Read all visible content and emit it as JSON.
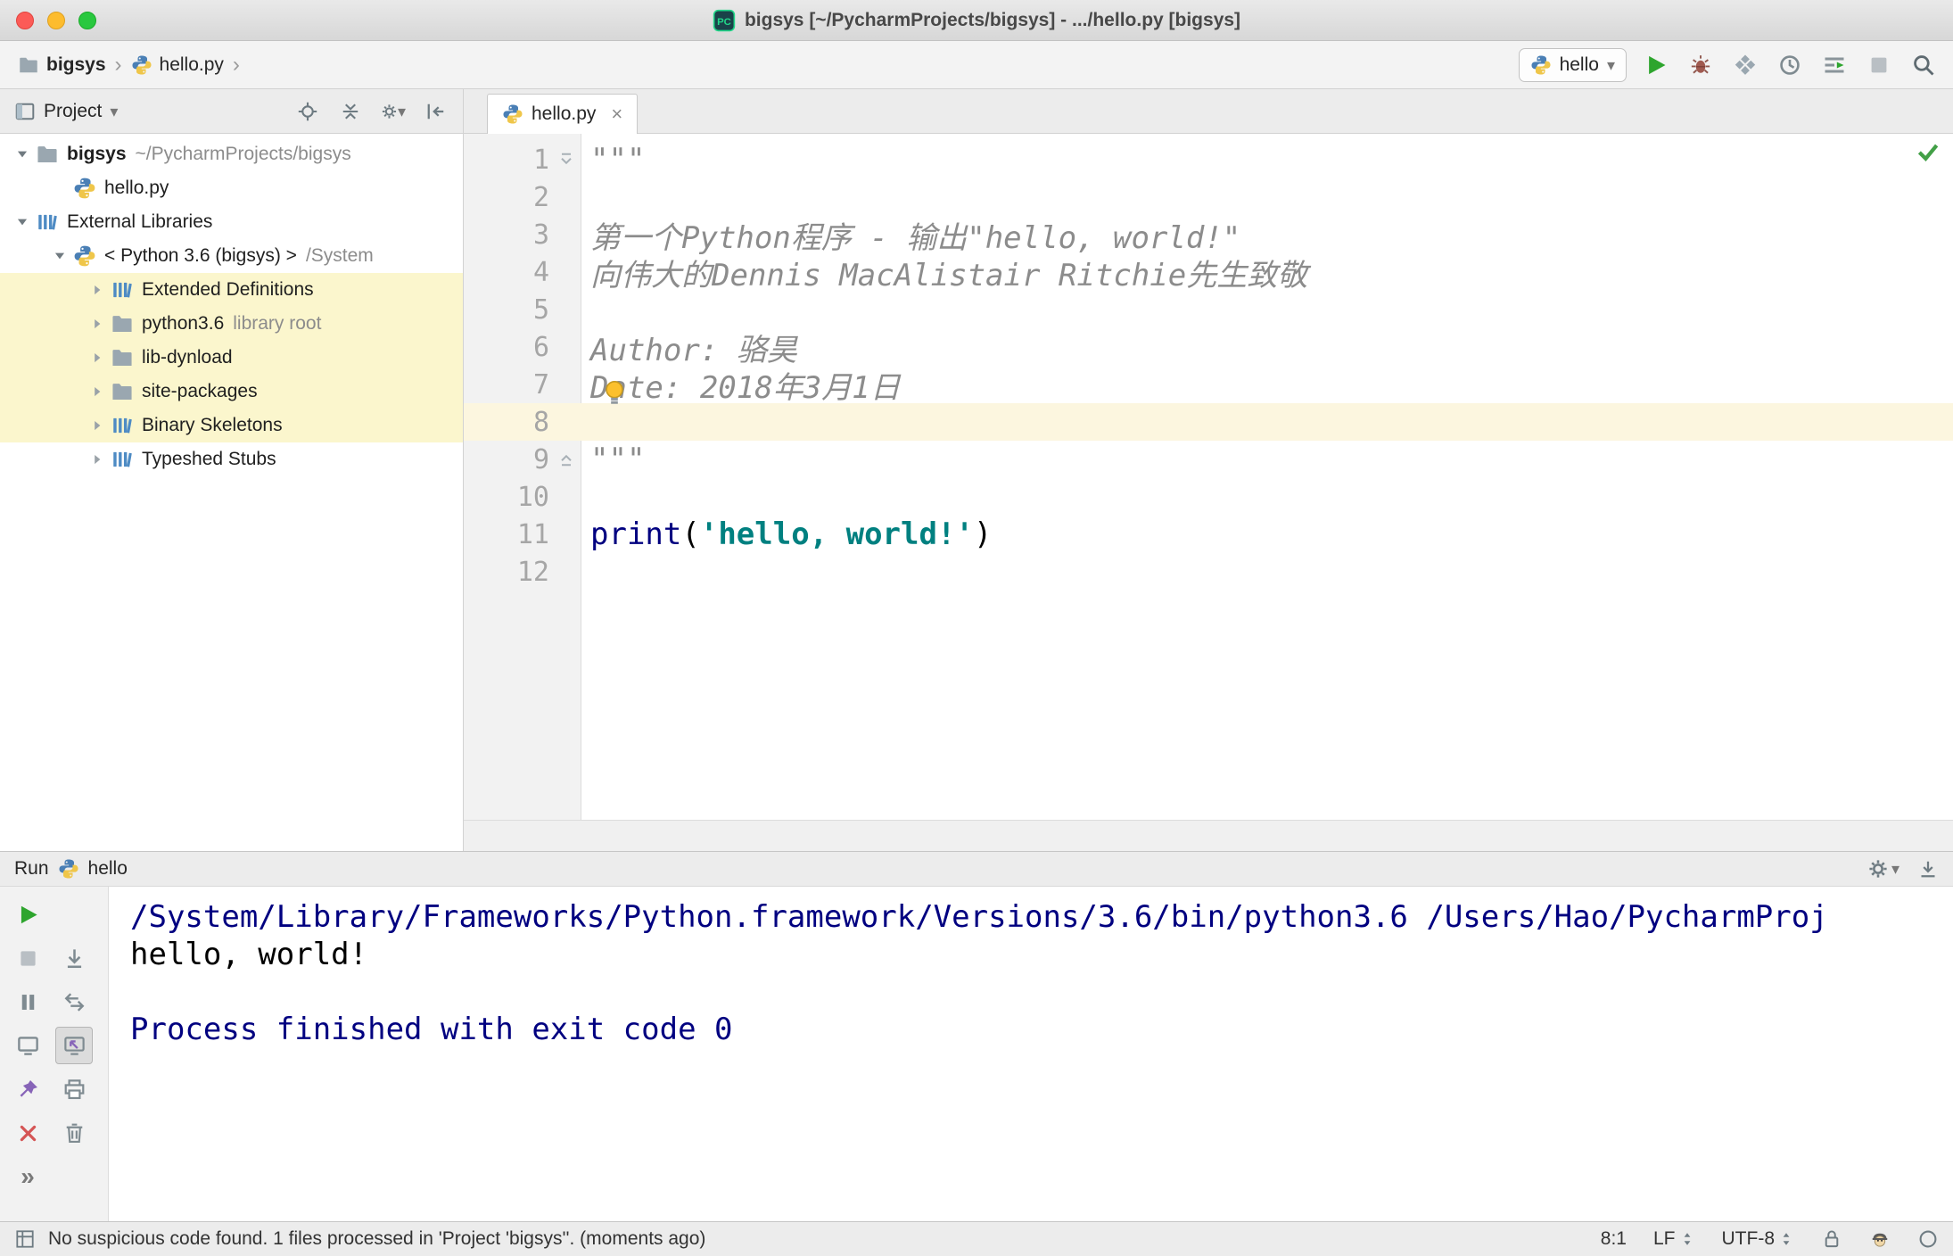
{
  "window": {
    "title": "bigsys [~/PycharmProjects/bigsys] - .../hello.py [bigsys]"
  },
  "colors": {
    "doc": "#8c8c8c",
    "builtin": "#000080",
    "string": "#008080",
    "plain": "#000000",
    "console": {
      "command": "#000080",
      "plain": "#000000",
      "system": "#000080"
    },
    "run_green": "#2ea52e",
    "tree_highlight": "#fbf6cd",
    "current_line": "#fcf6df"
  },
  "navbar": {
    "breadcrumbs": [
      {
        "label": "bigsys",
        "icon": "folder",
        "bold": true
      },
      {
        "label": "hello.py",
        "icon": "python",
        "bold": false
      }
    ],
    "run_config": {
      "label": "hello"
    },
    "actions": [
      {
        "name": "run",
        "icon": "run"
      },
      {
        "name": "debug",
        "icon": "debug"
      },
      {
        "name": "run-with-coverage",
        "icon": "coverage"
      },
      {
        "name": "profiler",
        "icon": "profiler"
      },
      {
        "name": "concurrency-diagram",
        "icon": "concurrency"
      },
      {
        "name": "stop",
        "icon": "stopDisabled"
      },
      {
        "name": "search-everywhere",
        "icon": "search"
      }
    ]
  },
  "project_panel": {
    "title": "Project",
    "toolbar": [
      {
        "name": "scroll-from-source",
        "icon": "locate"
      },
      {
        "name": "collapse-all",
        "icon": "collapse"
      },
      {
        "name": "settings",
        "icon": "gear",
        "dropdown": true
      },
      {
        "name": "hide-panel",
        "icon": "hideleft"
      }
    ],
    "tree": [
      {
        "label": "bigsys",
        "suffix": "~/PycharmProjects/bigsys",
        "icon": "folder",
        "chevron": "expanded",
        "level": 0,
        "bold": true
      },
      {
        "label": "hello.py",
        "icon": "python",
        "chevron": "none",
        "level": 1
      },
      {
        "label": "External Libraries",
        "icon": "library",
        "chevron": "expanded",
        "level": 0
      },
      {
        "label": "< Python 3.6 (bigsys) >",
        "suffix": "/System",
        "icon": "python",
        "chevron": "expanded",
        "level": 1
      },
      {
        "label": "Extended Definitions",
        "icon": "library",
        "chevron": "collapsed",
        "level": 2,
        "highlight": true
      },
      {
        "label": "python3.6",
        "suffix": "library root",
        "icon": "folder",
        "chevron": "collapsed",
        "level": 2,
        "highlight": true
      },
      {
        "label": "lib-dynload",
        "icon": "folder",
        "chevron": "collapsed",
        "level": 2,
        "highlight": true
      },
      {
        "label": "site-packages",
        "icon": "folder",
        "chevron": "collapsed",
        "level": 2,
        "highlight": true
      },
      {
        "label": "Binary Skeletons",
        "icon": "library",
        "chevron": "collapsed",
        "level": 2,
        "highlight": true
      },
      {
        "label": "Typeshed Stubs",
        "icon": "library",
        "chevron": "collapsed",
        "level": 2
      }
    ]
  },
  "editor": {
    "tab": {
      "label": "hello.py"
    },
    "current_line": 8,
    "lines": [
      {
        "n": 1,
        "fold": "start",
        "segments": [
          {
            "t": "\"\"\"",
            "c": "doc"
          }
        ]
      },
      {
        "n": 2,
        "segments": []
      },
      {
        "n": 3,
        "segments": [
          {
            "t": "第一个Python程序 - 输出\"hello, world!\"",
            "c": "doc"
          }
        ]
      },
      {
        "n": 4,
        "segments": [
          {
            "t": "向伟大的Dennis MacAlistair Ritchie先生致敬",
            "c": "doc"
          }
        ]
      },
      {
        "n": 5,
        "segments": []
      },
      {
        "n": 6,
        "segments": [
          {
            "t": "Author: 骆昊",
            "c": "doc"
          }
        ]
      },
      {
        "n": 7,
        "segments": [
          {
            "t": "Date: 2018年3月1日",
            "c": "doc"
          }
        ]
      },
      {
        "n": 8,
        "segments": []
      },
      {
        "n": 9,
        "fold": "end",
        "segments": [
          {
            "t": "\"\"\"",
            "c": "doc"
          }
        ]
      },
      {
        "n": 10,
        "segments": []
      },
      {
        "n": 11,
        "segments": [
          {
            "t": "print",
            "c": "builtin"
          },
          {
            "t": "(",
            "c": "plain"
          },
          {
            "t": "'hello, world!'",
            "c": "string"
          },
          {
            "t": ")",
            "c": "plain"
          }
        ]
      },
      {
        "n": 12,
        "segments": []
      }
    ]
  },
  "run_panel": {
    "title": "Run",
    "process": {
      "label": "hello"
    },
    "toolbar": [
      {
        "name": "rerun",
        "icon": "run",
        "col": 1,
        "row": 1
      },
      {
        "name": "stop",
        "icon": "stopDisabled",
        "col": 1,
        "row": 2
      },
      {
        "name": "scroll-to-end",
        "icon": "scrollend",
        "col": 2,
        "row": 2
      },
      {
        "name": "pause-output",
        "icon": "pause",
        "col": 1,
        "row": 3
      },
      {
        "name": "restore-layout",
        "icon": "restore",
        "col": 2,
        "row": 3
      },
      {
        "name": "thread-dump",
        "icon": "consoleIcon",
        "col": 1,
        "row": 4
      },
      {
        "name": "show-console-on-output",
        "icon": "consoleArrow",
        "col": 2,
        "row": 4,
        "selected": true
      },
      {
        "name": "attach",
        "icon": "pin",
        "col": 1,
        "row": 5
      },
      {
        "name": "print-console",
        "icon": "print",
        "col": 2,
        "row": 5
      },
      {
        "name": "close",
        "icon": "closex",
        "col": 1,
        "row": 6
      },
      {
        "name": "clear-all",
        "icon": "trash",
        "col": 2,
        "row": 6
      },
      {
        "name": "more-options",
        "icon": "more",
        "col": 1,
        "row": 7
      }
    ],
    "console": [
      {
        "text": "/System/Library/Frameworks/Python.framework/Versions/3.6/bin/python3.6 /Users/Hao/PycharmProj",
        "color": "command"
      },
      {
        "text": "hello, world!",
        "color": "plain"
      },
      {
        "text": "",
        "color": "plain"
      },
      {
        "text": "Process finished with exit code 0",
        "color": "system"
      }
    ]
  },
  "status_bar": {
    "message": "No suspicious code found. 1 files processed in 'Project 'bigsys''. (moments ago)",
    "position": "8:1",
    "line_separator": "LF",
    "encoding": "UTF-8"
  }
}
